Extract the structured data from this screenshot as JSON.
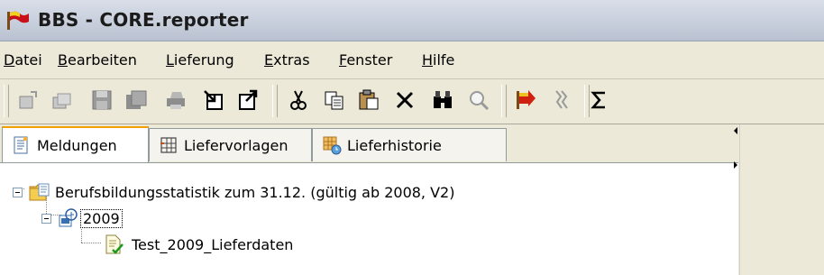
{
  "window": {
    "title": "BBS - CORE.reporter",
    "logo_icon": "flag-logo-icon"
  },
  "menu": [
    {
      "label": "Datei",
      "accel": "D"
    },
    {
      "label": "Bearbeiten",
      "accel": "B"
    },
    {
      "label": "Lieferung",
      "accel": "L"
    },
    {
      "label": "Extras",
      "accel": "E"
    },
    {
      "label": "Fenster",
      "accel": "F"
    },
    {
      "label": "Hilfe",
      "accel": "H"
    }
  ],
  "toolbar": {
    "buttons": [
      "open-icon",
      "save-as-icon",
      "save-icon",
      "save-all-icon",
      "print-icon",
      "import-icon",
      "export-icon",
      "cut-icon",
      "copy-icon",
      "paste-icon",
      "delete-icon",
      "find-icon",
      "search-icon",
      "send-icon",
      "check-icon",
      "sum-icon"
    ]
  },
  "tabs": [
    {
      "label": "Meldungen",
      "icon": "report-icon",
      "active": true
    },
    {
      "label": "Liefervorlagen",
      "icon": "template-icon",
      "active": false
    },
    {
      "label": "Lieferhistorie",
      "icon": "history-icon",
      "active": false
    }
  ],
  "tree": {
    "root": {
      "label": "Berufsbildungsstatistik zum 31.12. (gültig ab 2008, V2)",
      "icon": "folder-icon"
    },
    "child": {
      "label": "2009",
      "icon": "year-icon",
      "selected": true
    },
    "leaf": {
      "label": "Test_2009_Lieferdaten",
      "icon": "document-check-icon"
    }
  },
  "colors": {
    "window_bg": "#ece9d8",
    "titlebar": "#c8cfdc",
    "tab_active_border": "#f0a000"
  }
}
